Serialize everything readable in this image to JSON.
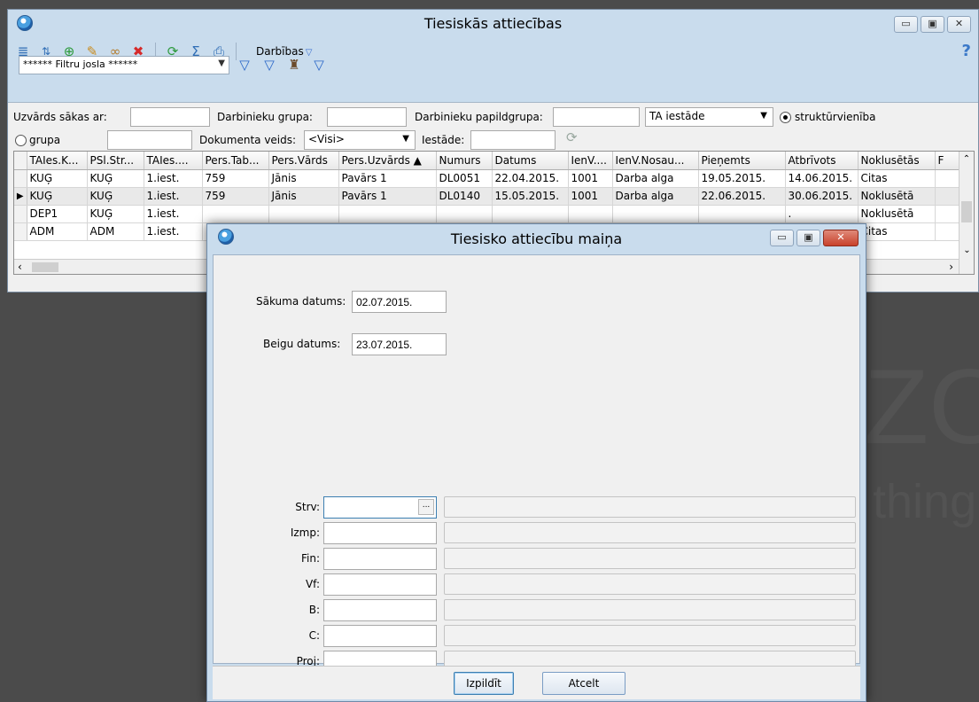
{
  "main_window": {
    "title": "Tiesiskās attiecības",
    "toolbar": {
      "actions_label": "Darbības",
      "help_glyph": "?"
    },
    "filter_bar": {
      "filter_combo_value": "****** Filtru josla ******"
    },
    "filters": {
      "surname_label": "Uzvārds sākas ar:",
      "surname_value": "",
      "emp_group_label": "Darbinieku grupa:",
      "emp_group_value": "",
      "emp_subgroup_label": "Darbinieku papildgrupa:",
      "emp_subgroup_value": "",
      "ta_select_value": "TA iestāde",
      "radio_struct_label": "struktūrvienība",
      "radio_group_label": "grupa",
      "group_value": "",
      "doc_type_label": "Dokumenta veids:",
      "doc_type_value": "<Visi>",
      "institution_label": "Iestāde:",
      "institution_value": ""
    },
    "table": {
      "columns": [
        "TAIes.K...",
        "PSl.Str...",
        "TAIes....",
        "Pers.Tab...",
        "Pers.Vārds",
        "Pers.Uzvārds ▲",
        "Numurs",
        "Datums",
        "IenV....",
        "IenV.Nosau...",
        "Pieņemts",
        "Atbrīvots",
        "Noklusētās",
        "F"
      ],
      "rows": [
        [
          "KUĢ",
          "KUĢ",
          "1.iest.",
          "759",
          "Jānis",
          "Pavārs 1",
          "DL0051",
          "22.04.2015.",
          "1001",
          "Darba alga",
          "19.05.2015.",
          "14.06.2015.",
          "Citas",
          ""
        ],
        [
          "KUĢ",
          "KUĢ",
          "1.iest.",
          "759",
          "Jānis",
          "Pavārs 1",
          "DL0140",
          "15.05.2015.",
          "1001",
          "Darba alga",
          "22.06.2015.",
          "30.06.2015.",
          "Noklusētā",
          ""
        ],
        [
          "DEP1",
          "KUĢ",
          "1.iest.",
          "",
          "",
          "",
          "",
          "",
          "",
          "",
          "",
          ".",
          "Noklusētā",
          ""
        ],
        [
          "ADM",
          "ADM",
          "1.iest.",
          "",
          "",
          "",
          "",
          "",
          "",
          "",
          "",
          "",
          "Citas",
          ""
        ]
      ],
      "current_row_marker": "▶"
    },
    "background_watermark": {
      "big": "ZO",
      "small": "thing"
    }
  },
  "dialog": {
    "title": "Tiesisko attiecību maiņa",
    "start_date_label": "Sākuma datums:",
    "start_date_value": "02.07.2015.",
    "end_date_label": "Beigu datums:",
    "end_date_value": "23.07.2015.",
    "fields": [
      {
        "label": "Strv:",
        "value": "",
        "description": ""
      },
      {
        "label": "Izmp:",
        "value": "",
        "description": ""
      },
      {
        "label": "Fin:",
        "value": "",
        "description": ""
      },
      {
        "label": "Vf:",
        "value": "",
        "description": ""
      },
      {
        "label": "B:",
        "value": "",
        "description": ""
      },
      {
        "label": "C:",
        "value": "",
        "description": ""
      },
      {
        "label": "Proj:",
        "value": "",
        "description": ""
      }
    ],
    "ellipsis_glyph": "...",
    "execute_label": "Izpildīt",
    "cancel_label": "Atcelt"
  }
}
